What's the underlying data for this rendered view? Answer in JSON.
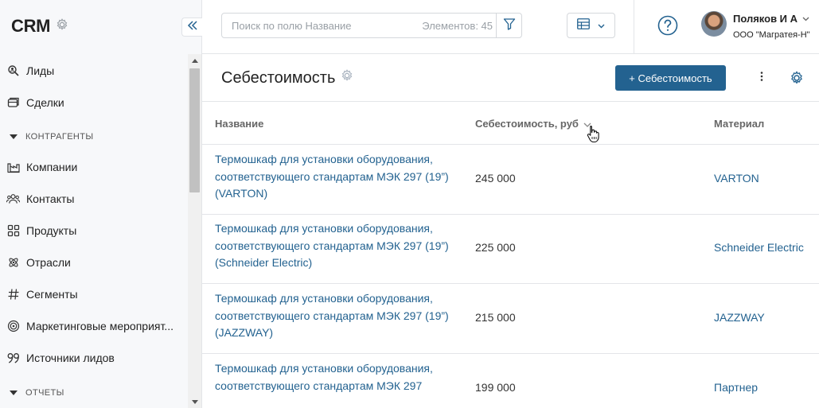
{
  "app": {
    "title": "CRM",
    "collapse_icon": "double-chevron-left-icon"
  },
  "sidebar": {
    "items": [
      {
        "label": "Лиды",
        "icon": "search-person-icon"
      },
      {
        "label": "Сделки",
        "icon": "deals-icon"
      },
      {
        "label": "Компании",
        "icon": "company-icon"
      },
      {
        "label": "Контакты",
        "icon": "contacts-icon"
      },
      {
        "label": "Продукты",
        "icon": "grid-icon"
      },
      {
        "label": "Отрасли",
        "icon": "atom-icon"
      },
      {
        "label": "Сегменты",
        "icon": "hash-icon"
      },
      {
        "label": "Маркетинговые мероприят...",
        "icon": "target-icon"
      },
      {
        "label": "Источники лидов",
        "icon": "quote-icon"
      }
    ],
    "sections": [
      {
        "label": "КОНТРАГЕНТЫ"
      },
      {
        "label": "ОТЧЕТЫ"
      }
    ]
  },
  "topbar": {
    "search_placeholder": "Поиск по полю Название",
    "count_label": "Элементов: 45",
    "user": {
      "name": "Поляков И А",
      "org": "ООО \"Магратея-Н\""
    }
  },
  "page": {
    "title": "Себестоимость",
    "add_button": "+ Себестоимость"
  },
  "table": {
    "columns": [
      "Название",
      "Себестоимость, руб",
      "Материал"
    ],
    "rows": [
      {
        "name": "Термошкаф для установки оборудования, соответствующего стандартам МЭК 297 (19”)(VARTON)",
        "cost": "245 000",
        "material": "VARTON"
      },
      {
        "name": "Термошкаф для установки оборудования, соответствующего стандартам МЭК 297 (19”)(Schneider Electric)",
        "cost": "225 000",
        "material": "Schneider Electric"
      },
      {
        "name": "Термошкаф для установки оборудования, соответствующего стандартам МЭК 297 (19”)(JAZZWAY)",
        "cost": "215 000",
        "material": "JAZZWAY"
      },
      {
        "name": "Термошкаф для установки оборудования, соответствующего стандартам МЭК 297",
        "cost": "199 000",
        "material": "Партнер"
      }
    ]
  },
  "colors": {
    "accent": "#236290",
    "sidebar_bg": "#f7f8fa",
    "border": "#e3e5e8"
  }
}
